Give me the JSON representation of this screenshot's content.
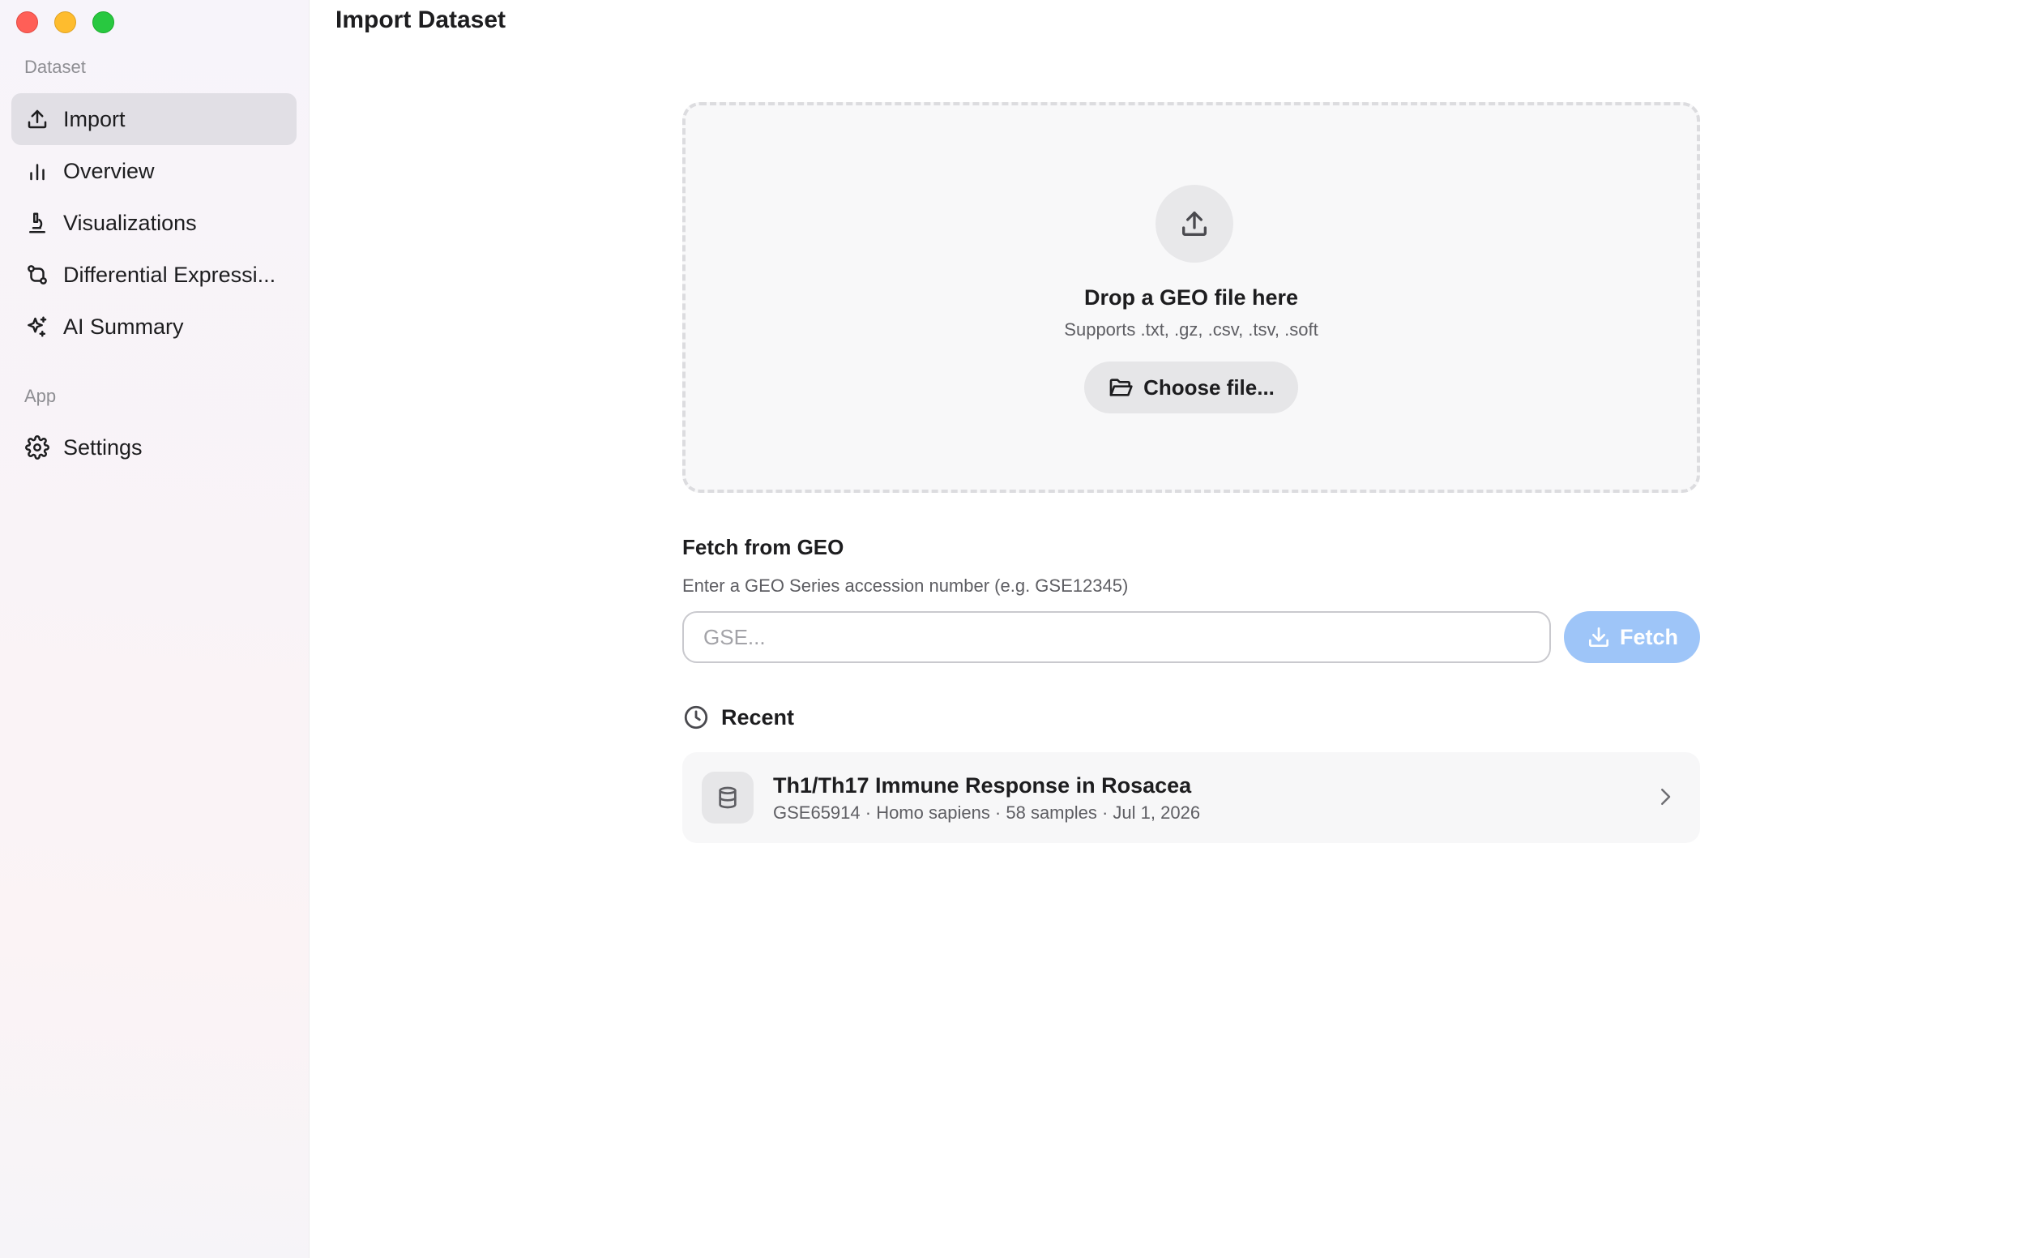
{
  "window": {
    "controls": [
      "close",
      "minimize",
      "maximize"
    ]
  },
  "sidebar": {
    "sections": [
      {
        "label": "Dataset"
      },
      {
        "label": "App"
      }
    ],
    "items": [
      {
        "label": "Import",
        "icon": "upload-icon",
        "active": true
      },
      {
        "label": "Overview",
        "icon": "bar-chart-icon"
      },
      {
        "label": "Visualizations",
        "icon": "microscope-icon"
      },
      {
        "label": "Differential Expressi...",
        "icon": "git-compare-icon"
      },
      {
        "label": "AI Summary",
        "icon": "sparkles-icon"
      },
      {
        "label": "Settings",
        "icon": "gear-icon"
      }
    ]
  },
  "header": {
    "title": "Import Dataset"
  },
  "dropzone": {
    "title": "Drop a GEO file here",
    "subtitle": "Supports .txt, .gz, .csv, .tsv, .soft",
    "button_label": "Choose file..."
  },
  "fetch": {
    "title": "Fetch from GEO",
    "description": "Enter a GEO Series accession number (e.g. GSE12345)",
    "input_value": "",
    "placeholder": "GSE...",
    "button_label": "Fetch"
  },
  "recent": {
    "title": "Recent",
    "items": [
      {
        "title": "Th1/Th17 Immune Response in Rosacea",
        "meta": "GSE65914 · Homo sapiens · 58 samples · Jul 1, 2026"
      }
    ]
  },
  "colors": {
    "accent_disabled": "#9ec5f8",
    "sidebar_active": "#e1dfe5",
    "close": "#ff5f57",
    "minimize": "#febc2e",
    "maximize": "#28c840"
  }
}
